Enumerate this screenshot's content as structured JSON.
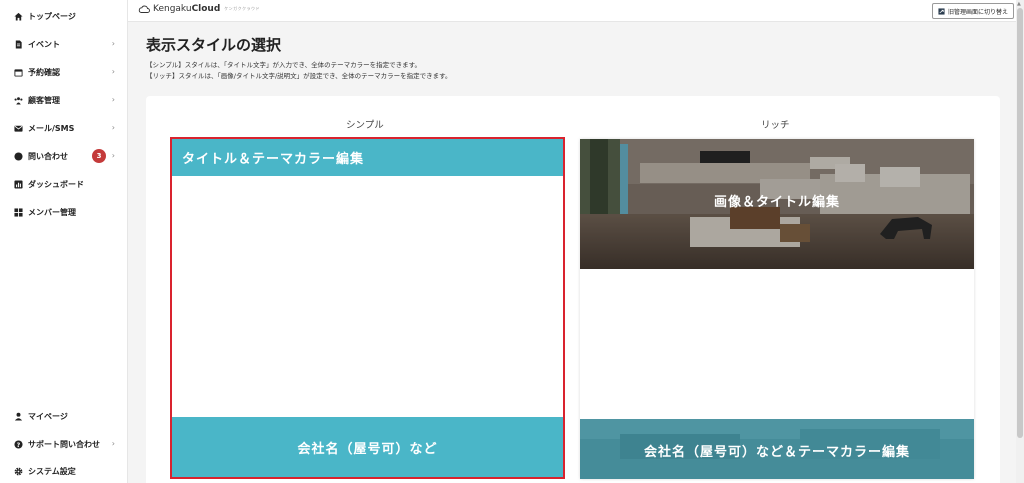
{
  "sidebar": {
    "items": [
      {
        "label": "トップページ",
        "icon": "home-icon",
        "chevron": false
      },
      {
        "label": "イベント",
        "icon": "document-icon",
        "chevron": true
      },
      {
        "label": "予約確認",
        "icon": "calendar-icon",
        "chevron": true
      },
      {
        "label": "顧客管理",
        "icon": "users-icon",
        "chevron": true
      },
      {
        "label": "メール/SMS",
        "icon": "mail-icon",
        "chevron": true
      },
      {
        "label": "問い合わせ",
        "icon": "chat-icon",
        "chevron": true,
        "badge": "3"
      },
      {
        "label": "ダッシュボード",
        "icon": "chart-icon",
        "chevron": false
      },
      {
        "label": "メンバー管理",
        "icon": "grid-icon",
        "chevron": false
      }
    ],
    "bottom_items": [
      {
        "label": "マイページ",
        "icon": "person-icon",
        "chevron": false
      },
      {
        "label": "サポート問い合わせ",
        "icon": "help-icon",
        "chevron": true
      },
      {
        "label": "システム設定",
        "icon": "gear-icon",
        "chevron": false
      }
    ],
    "chevron_glyph": "›"
  },
  "header": {
    "brand_light": "Kengaku",
    "brand_bold": "Cloud",
    "brand_sub": "ケンガククラウド",
    "switch_button": "旧管理画面に切り替え"
  },
  "main": {
    "title": "表示スタイルの選択",
    "desc_lines": [
      "【シンプル】スタイルは、「タイトル文字」が入力でき、全体のテーマカラーを指定できます。",
      "【リッチ】スタイルは、「画像/タイトル文字/説明文」が設定でき、全体のテーマカラーを指定できます。"
    ],
    "simple": {
      "label": "シンプル",
      "header_text": "タイトル＆テーマカラー編集",
      "footer_text": "会社名（屋号可）など"
    },
    "rich": {
      "label": "リッチ",
      "image_title": "画像＆タイトル編集",
      "footer_text": "会社名（屋号可）など＆テーマカラー編集"
    }
  },
  "colors": {
    "theme": "#4ab6c8",
    "selected_border": "#d9232e",
    "badge": "#c43a3a"
  }
}
